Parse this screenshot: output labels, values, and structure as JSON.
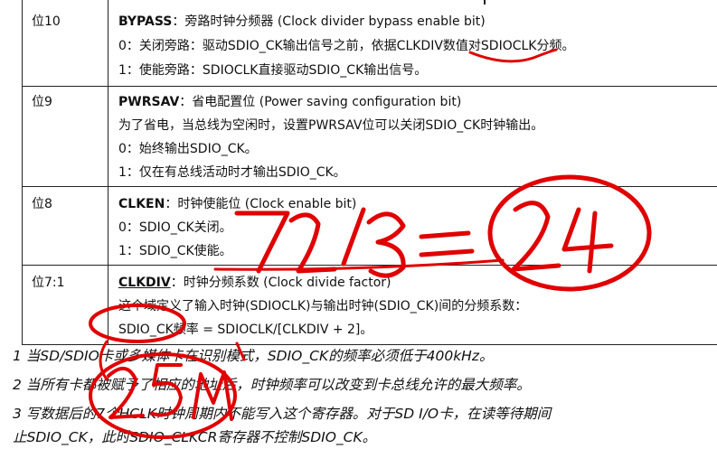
{
  "rows": [
    {
      "bit": "位10",
      "field": "BYPASS",
      "desc": "：旁路时钟分频器 (Clock divider bypass enable bit)",
      "lines": [
        "0：关闭旁路：驱动SDIO_CK输出信号之前，依据CLKDIV数值对SDIOCLK分频。",
        "1：使能旁路：SDIOCLK直接驱动SDIO_CK输出信号。"
      ]
    },
    {
      "bit": "位9",
      "field": "PWRSAV",
      "desc": "：省电配置位 (Power saving configuration bit)",
      "lines": [
        "为了省电，当总线为空闲时，设置PWRSAV位可以关闭SDIO_CK时钟输出。",
        "0：始终输出SDIO_CK。",
        "1：仅在有总线活动时才输出SDIO_CK。"
      ]
    },
    {
      "bit": "位8",
      "field": "CLKEN",
      "desc": "：时钟使能位 (Clock enable bit)",
      "lines": [
        "0：SDIO_CK关闭。",
        "1：SDIO_CK使能。"
      ]
    },
    {
      "bit": "位7:1",
      "field": "CLKDIV",
      "desc": "：时钟分频系数 (Clock divide factor)",
      "lines": [
        "这个域定义了输入时钟(SDIOCLK)与输出时钟(SDIO_CK)间的分频系数：",
        "SDIO_CK频率 = SDIOCLK/[CLKDIV + 2]。"
      ]
    }
  ],
  "notes": [
    "1 当SD/SDIO卡或多媒体卡在识别模式，SDIO_CK的频率必须低于400kHz。",
    "2 当所有卡都被赋予了相应的地址后，时钟频率可以改变到卡总线允许的最大频率。",
    "3 写数据后的7个HCLK时钟周期内不能写入这个寄存器。对于SD I/O卡，在读等待期间",
    "止SDIO_CK，此时SDIO_CLKCR寄存器不控制SDIO_CK。"
  ],
  "annotation_color": "#e00000"
}
